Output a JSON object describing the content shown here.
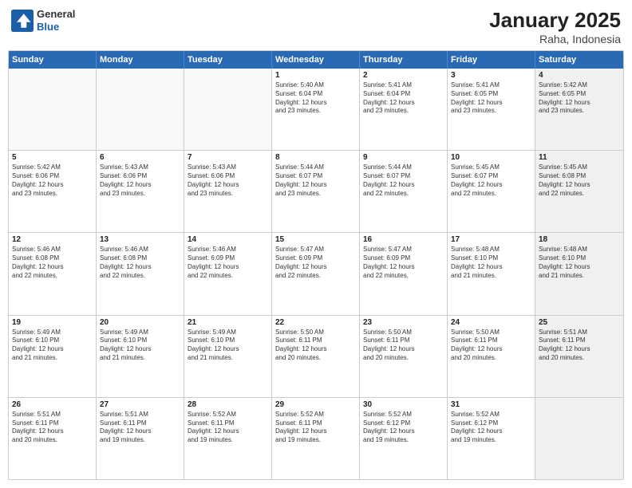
{
  "header": {
    "logo_line1": "General",
    "logo_line2": "Blue",
    "title": "January 2025",
    "subtitle": "Raha, Indonesia"
  },
  "weekdays": [
    "Sunday",
    "Monday",
    "Tuesday",
    "Wednesday",
    "Thursday",
    "Friday",
    "Saturday"
  ],
  "rows": [
    [
      {
        "day": "",
        "info": "",
        "shaded": false,
        "empty": true
      },
      {
        "day": "",
        "info": "",
        "shaded": false,
        "empty": true
      },
      {
        "day": "",
        "info": "",
        "shaded": false,
        "empty": true
      },
      {
        "day": "1",
        "info": "Sunrise: 5:40 AM\nSunset: 6:04 PM\nDaylight: 12 hours\nand 23 minutes.",
        "shaded": false,
        "empty": false
      },
      {
        "day": "2",
        "info": "Sunrise: 5:41 AM\nSunset: 6:04 PM\nDaylight: 12 hours\nand 23 minutes.",
        "shaded": false,
        "empty": false
      },
      {
        "day": "3",
        "info": "Sunrise: 5:41 AM\nSunset: 6:05 PM\nDaylight: 12 hours\nand 23 minutes.",
        "shaded": false,
        "empty": false
      },
      {
        "day": "4",
        "info": "Sunrise: 5:42 AM\nSunset: 6:05 PM\nDaylight: 12 hours\nand 23 minutes.",
        "shaded": true,
        "empty": false
      }
    ],
    [
      {
        "day": "5",
        "info": "Sunrise: 5:42 AM\nSunset: 6:06 PM\nDaylight: 12 hours\nand 23 minutes.",
        "shaded": false,
        "empty": false
      },
      {
        "day": "6",
        "info": "Sunrise: 5:43 AM\nSunset: 6:06 PM\nDaylight: 12 hours\nand 23 minutes.",
        "shaded": false,
        "empty": false
      },
      {
        "day": "7",
        "info": "Sunrise: 5:43 AM\nSunset: 6:06 PM\nDaylight: 12 hours\nand 23 minutes.",
        "shaded": false,
        "empty": false
      },
      {
        "day": "8",
        "info": "Sunrise: 5:44 AM\nSunset: 6:07 PM\nDaylight: 12 hours\nand 23 minutes.",
        "shaded": false,
        "empty": false
      },
      {
        "day": "9",
        "info": "Sunrise: 5:44 AM\nSunset: 6:07 PM\nDaylight: 12 hours\nand 22 minutes.",
        "shaded": false,
        "empty": false
      },
      {
        "day": "10",
        "info": "Sunrise: 5:45 AM\nSunset: 6:07 PM\nDaylight: 12 hours\nand 22 minutes.",
        "shaded": false,
        "empty": false
      },
      {
        "day": "11",
        "info": "Sunrise: 5:45 AM\nSunset: 6:08 PM\nDaylight: 12 hours\nand 22 minutes.",
        "shaded": true,
        "empty": false
      }
    ],
    [
      {
        "day": "12",
        "info": "Sunrise: 5:46 AM\nSunset: 6:08 PM\nDaylight: 12 hours\nand 22 minutes.",
        "shaded": false,
        "empty": false
      },
      {
        "day": "13",
        "info": "Sunrise: 5:46 AM\nSunset: 6:08 PM\nDaylight: 12 hours\nand 22 minutes.",
        "shaded": false,
        "empty": false
      },
      {
        "day": "14",
        "info": "Sunrise: 5:46 AM\nSunset: 6:09 PM\nDaylight: 12 hours\nand 22 minutes.",
        "shaded": false,
        "empty": false
      },
      {
        "day": "15",
        "info": "Sunrise: 5:47 AM\nSunset: 6:09 PM\nDaylight: 12 hours\nand 22 minutes.",
        "shaded": false,
        "empty": false
      },
      {
        "day": "16",
        "info": "Sunrise: 5:47 AM\nSunset: 6:09 PM\nDaylight: 12 hours\nand 22 minutes.",
        "shaded": false,
        "empty": false
      },
      {
        "day": "17",
        "info": "Sunrise: 5:48 AM\nSunset: 6:10 PM\nDaylight: 12 hours\nand 21 minutes.",
        "shaded": false,
        "empty": false
      },
      {
        "day": "18",
        "info": "Sunrise: 5:48 AM\nSunset: 6:10 PM\nDaylight: 12 hours\nand 21 minutes.",
        "shaded": true,
        "empty": false
      }
    ],
    [
      {
        "day": "19",
        "info": "Sunrise: 5:49 AM\nSunset: 6:10 PM\nDaylight: 12 hours\nand 21 minutes.",
        "shaded": false,
        "empty": false
      },
      {
        "day": "20",
        "info": "Sunrise: 5:49 AM\nSunset: 6:10 PM\nDaylight: 12 hours\nand 21 minutes.",
        "shaded": false,
        "empty": false
      },
      {
        "day": "21",
        "info": "Sunrise: 5:49 AM\nSunset: 6:10 PM\nDaylight: 12 hours\nand 21 minutes.",
        "shaded": false,
        "empty": false
      },
      {
        "day": "22",
        "info": "Sunrise: 5:50 AM\nSunset: 6:11 PM\nDaylight: 12 hours\nand 20 minutes.",
        "shaded": false,
        "empty": false
      },
      {
        "day": "23",
        "info": "Sunrise: 5:50 AM\nSunset: 6:11 PM\nDaylight: 12 hours\nand 20 minutes.",
        "shaded": false,
        "empty": false
      },
      {
        "day": "24",
        "info": "Sunrise: 5:50 AM\nSunset: 6:11 PM\nDaylight: 12 hours\nand 20 minutes.",
        "shaded": false,
        "empty": false
      },
      {
        "day": "25",
        "info": "Sunrise: 5:51 AM\nSunset: 6:11 PM\nDaylight: 12 hours\nand 20 minutes.",
        "shaded": true,
        "empty": false
      }
    ],
    [
      {
        "day": "26",
        "info": "Sunrise: 5:51 AM\nSunset: 6:11 PM\nDaylight: 12 hours\nand 20 minutes.",
        "shaded": false,
        "empty": false
      },
      {
        "day": "27",
        "info": "Sunrise: 5:51 AM\nSunset: 6:11 PM\nDaylight: 12 hours\nand 19 minutes.",
        "shaded": false,
        "empty": false
      },
      {
        "day": "28",
        "info": "Sunrise: 5:52 AM\nSunset: 6:11 PM\nDaylight: 12 hours\nand 19 minutes.",
        "shaded": false,
        "empty": false
      },
      {
        "day": "29",
        "info": "Sunrise: 5:52 AM\nSunset: 6:11 PM\nDaylight: 12 hours\nand 19 minutes.",
        "shaded": false,
        "empty": false
      },
      {
        "day": "30",
        "info": "Sunrise: 5:52 AM\nSunset: 6:12 PM\nDaylight: 12 hours\nand 19 minutes.",
        "shaded": false,
        "empty": false
      },
      {
        "day": "31",
        "info": "Sunrise: 5:52 AM\nSunset: 6:12 PM\nDaylight: 12 hours\nand 19 minutes.",
        "shaded": false,
        "empty": false
      },
      {
        "day": "",
        "info": "",
        "shaded": true,
        "empty": true
      }
    ]
  ]
}
